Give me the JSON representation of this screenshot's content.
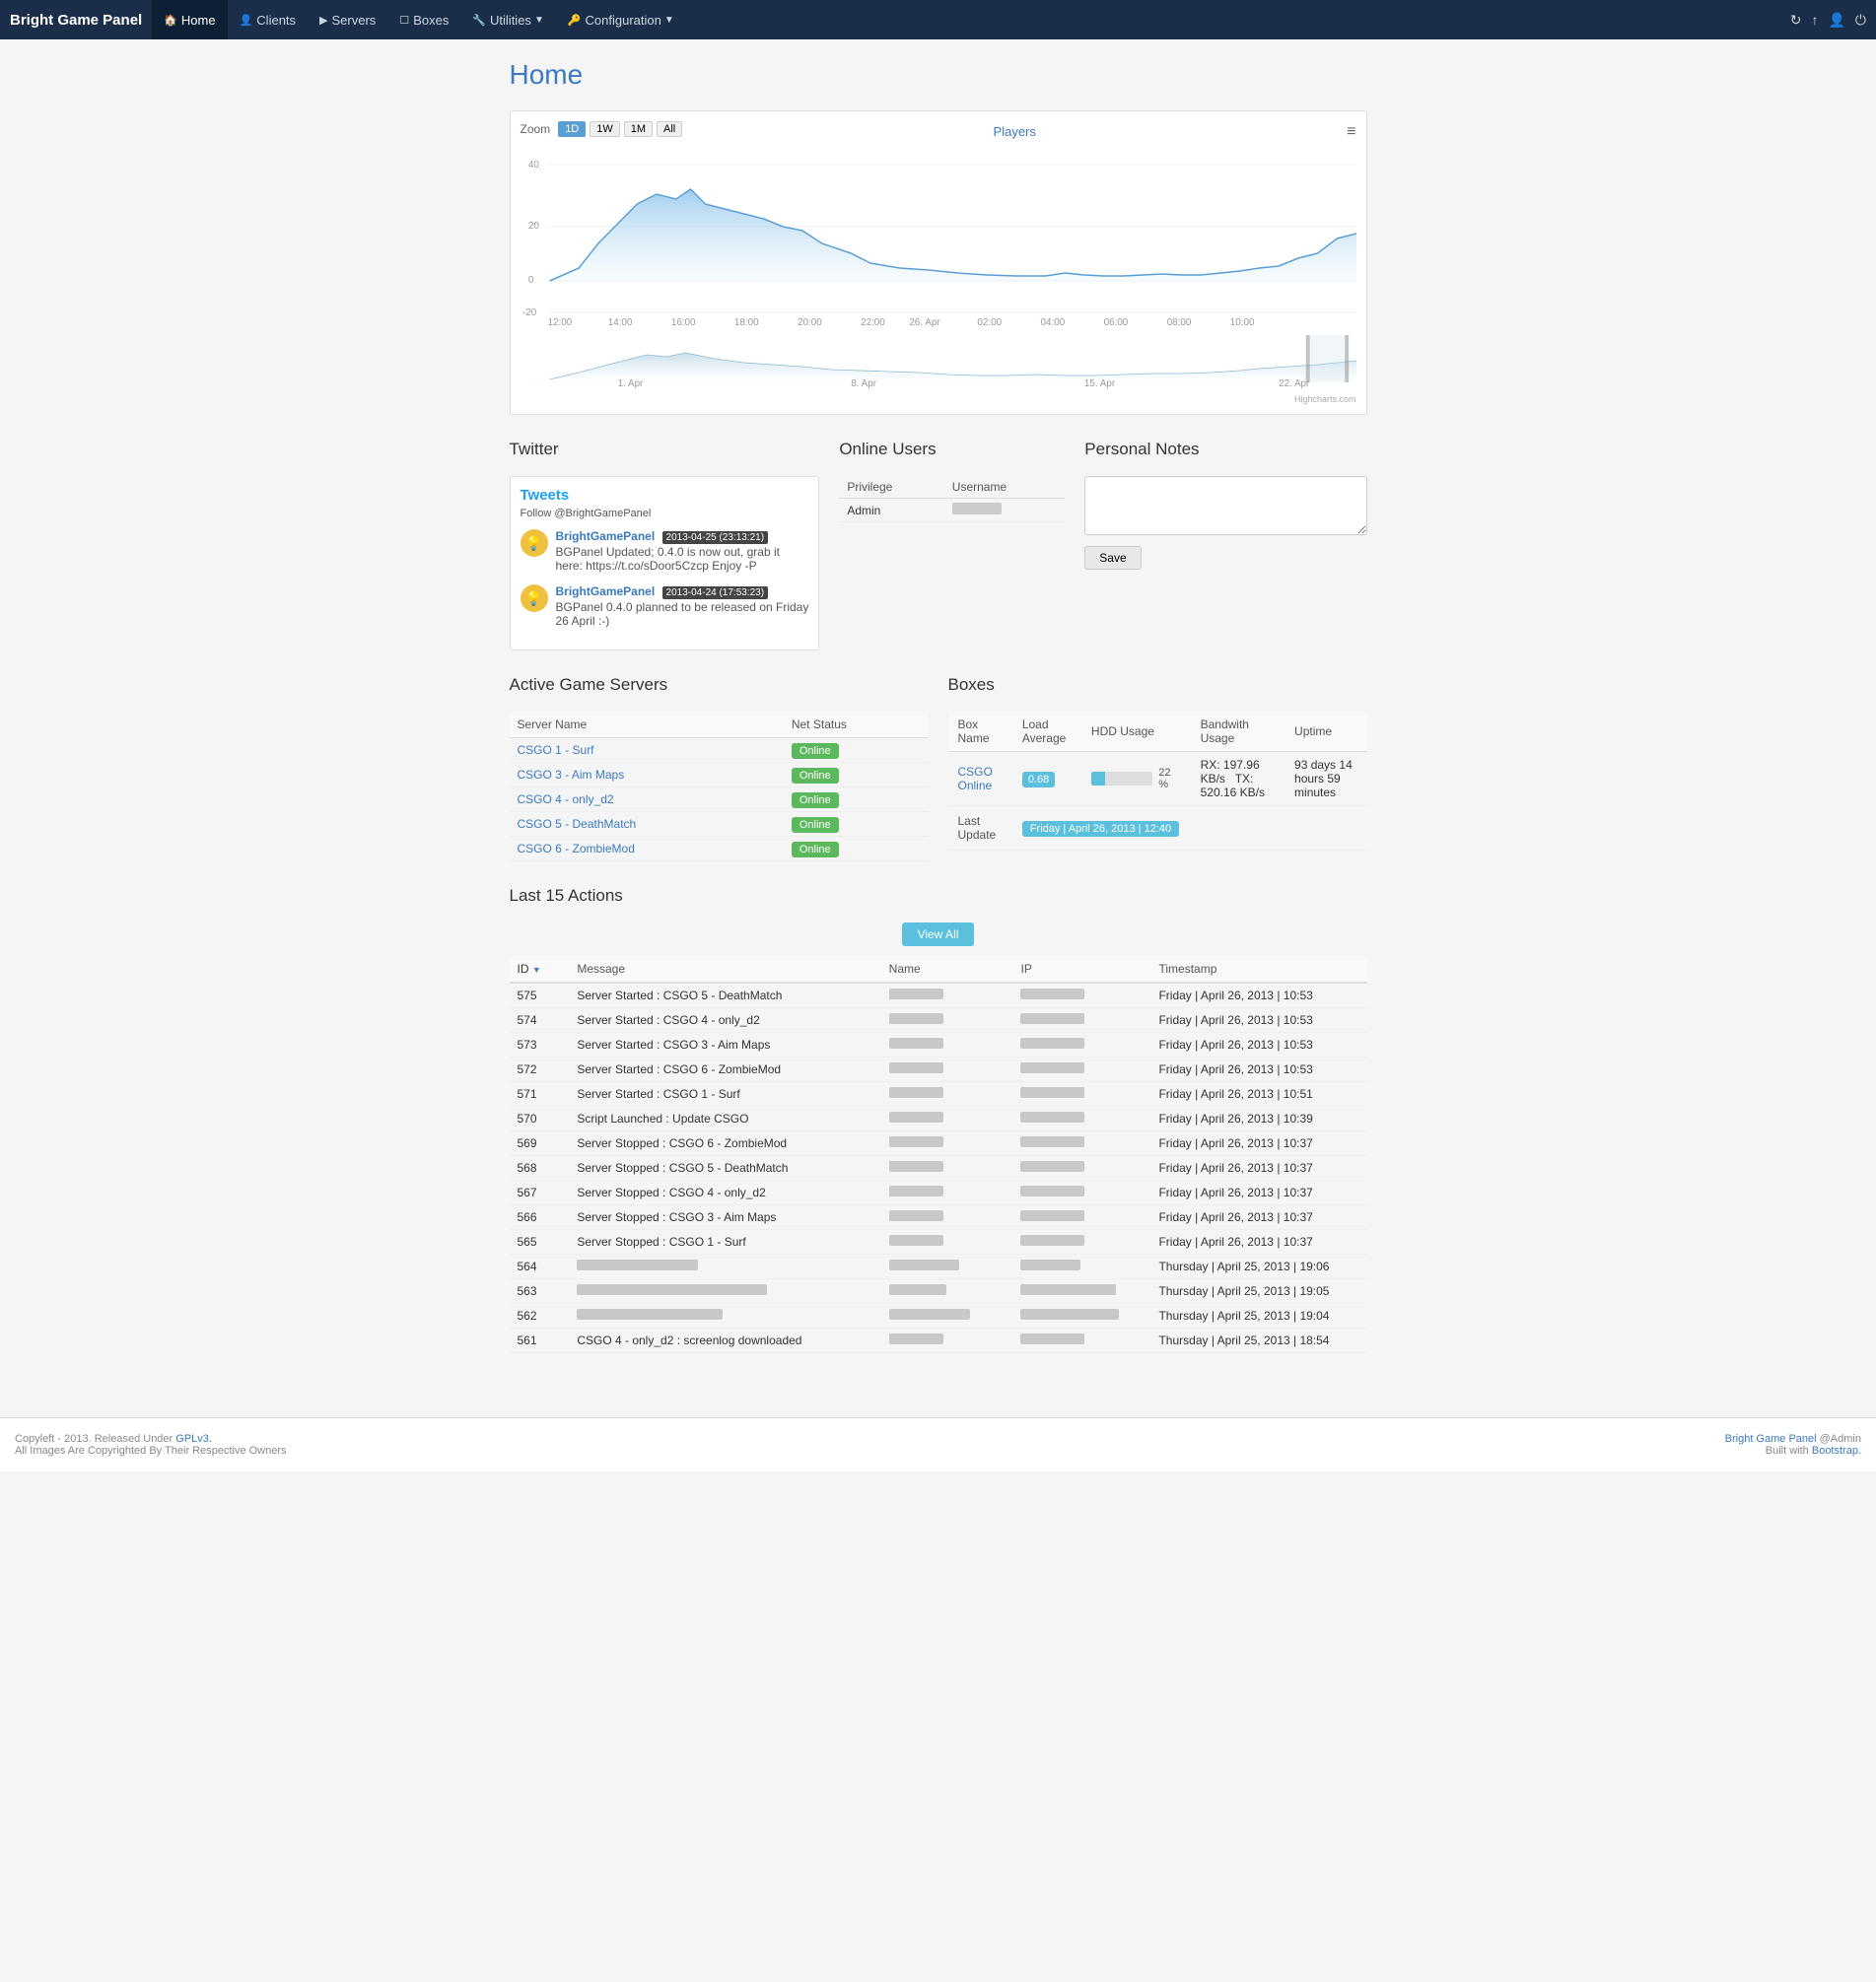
{
  "app": {
    "brand": "Bright Game Panel",
    "page_title": "Home"
  },
  "navbar": {
    "items": [
      {
        "label": "Home",
        "icon": "🏠",
        "active": true
      },
      {
        "label": "Clients",
        "icon": "👤",
        "active": false
      },
      {
        "label": "Servers",
        "icon": "▶",
        "active": false
      },
      {
        "label": "Boxes",
        "icon": "☐",
        "active": false
      },
      {
        "label": "Utilities",
        "icon": "🔧",
        "active": false,
        "dropdown": true
      },
      {
        "label": "Configuration",
        "icon": "🔑",
        "active": false,
        "dropdown": true
      }
    ],
    "right_icons": [
      "refresh-icon",
      "upload-icon",
      "user-icon",
      "settings-icon"
    ]
  },
  "chart": {
    "title": "Players",
    "zoom_label": "Zoom",
    "zoom_options": [
      "1D",
      "1W",
      "1M",
      "All"
    ],
    "zoom_active": "1D",
    "y_labels": [
      "40",
      "20",
      "0",
      "-20"
    ],
    "x_labels": [
      "12:00",
      "14:00",
      "16:00",
      "18:00",
      "20:00",
      "22:00",
      "26. Apr",
      "02:00",
      "04:00",
      "06:00",
      "08:00",
      "10:00"
    ],
    "mini_labels": [
      "1. Apr",
      "8. Apr",
      "15. Apr",
      "22. Apr"
    ],
    "credit": "Highcharts.com"
  },
  "twitter": {
    "section_title": "Twitter",
    "tweets_label": "Tweets",
    "follow_label": "Follow @BrightGamePanel",
    "items": [
      {
        "user": "BrightGamePanel",
        "date": "2013-04-25 (23:13:21)",
        "text": "BGPanel Updated; 0.4.0 is now out, grab it here: https://t.co/sDoor5Czcp Enjoy -P"
      },
      {
        "user": "BrightGamePanel",
        "date": "2013-04-24 (17:53:23)",
        "text": "BGPanel 0.4.0 planned to be released on Friday 26 April :-)"
      }
    ]
  },
  "online_users": {
    "section_title": "Online Users",
    "columns": [
      "Privilege",
      "Username"
    ],
    "rows": [
      {
        "privilege": "Admin",
        "username": ""
      }
    ]
  },
  "personal_notes": {
    "section_title": "Personal Notes",
    "placeholder": "",
    "save_label": "Save"
  },
  "active_servers": {
    "section_title": "Active Game Servers",
    "columns": [
      "Server Name",
      "Net Status"
    ],
    "rows": [
      {
        "name": "CSGO 1 - Surf",
        "status": "Online"
      },
      {
        "name": "CSGO 3 - Aim Maps",
        "status": "Online"
      },
      {
        "name": "CSGO 4 - only_d2",
        "status": "Online"
      },
      {
        "name": "CSGO 5 - DeathMatch",
        "status": "Online"
      },
      {
        "name": "CSGO 6 - ZombieMod",
        "status": "Online"
      }
    ]
  },
  "boxes": {
    "section_title": "Boxes",
    "columns": [
      "Box Name",
      "Load Average",
      "HDD Usage",
      "Bandwith Usage",
      "Uptime"
    ],
    "rows": [
      {
        "name": "CSGO Online",
        "load_average": "0.68",
        "hdd_percent": 22,
        "hdd_label": "22 %",
        "bandwidth": "RX: 197.96 KB/s   TX: 520.16 KB/s",
        "uptime": "93 days 14 hours 59 minutes"
      }
    ],
    "last_update_label": "Last Update",
    "last_update_value": "Friday | April 26, 2013 | 12:40"
  },
  "last_actions": {
    "section_title": "Last 15 Actions",
    "view_all_label": "View All",
    "columns": [
      "ID",
      "Message",
      "Name",
      "IP",
      "Timestamp"
    ],
    "rows": [
      {
        "id": "575",
        "message": "Server Started : CSGO 5 - DeathMatch",
        "name": "",
        "ip": "",
        "timestamp": "Friday | April 26, 2013 | 10:53",
        "blurred": false
      },
      {
        "id": "574",
        "message": "Server Started : CSGO 4 - only_d2",
        "name": "",
        "ip": "",
        "timestamp": "Friday | April 26, 2013 | 10:53",
        "blurred": false
      },
      {
        "id": "573",
        "message": "Server Started : CSGO 3 - Aim Maps",
        "name": "",
        "ip": "",
        "timestamp": "Friday | April 26, 2013 | 10:53",
        "blurred": false
      },
      {
        "id": "572",
        "message": "Server Started : CSGO 6 - ZombieMod",
        "name": "",
        "ip": "",
        "timestamp": "Friday | April 26, 2013 | 10:53",
        "blurred": false
      },
      {
        "id": "571",
        "message": "Server Started : CSGO 1 - Surf",
        "name": "",
        "ip": "",
        "timestamp": "Friday | April 26, 2013 | 10:51",
        "blurred": false
      },
      {
        "id": "570",
        "message": "Script Launched : Update CSGO",
        "name": "",
        "ip": "",
        "timestamp": "Friday | April 26, 2013 | 10:39",
        "blurred": false
      },
      {
        "id": "569",
        "message": "Server Stopped : CSGO 6 - ZombieMod",
        "name": "",
        "ip": "",
        "timestamp": "Friday | April 26, 2013 | 10:37",
        "blurred": false
      },
      {
        "id": "568",
        "message": "Server Stopped : CSGO 5 - DeathMatch",
        "name": "",
        "ip": "",
        "timestamp": "Friday | April 26, 2013 | 10:37",
        "blurred": false
      },
      {
        "id": "567",
        "message": "Server Stopped : CSGO 4 - only_d2",
        "name": "",
        "ip": "",
        "timestamp": "Friday | April 26, 2013 | 10:37",
        "blurred": false
      },
      {
        "id": "566",
        "message": "Server Stopped : CSGO 3 - Aim Maps",
        "name": "",
        "ip": "",
        "timestamp": "Friday | April 26, 2013 | 10:37",
        "blurred": false
      },
      {
        "id": "565",
        "message": "Server Stopped : CSGO 1 - Surf",
        "name": "",
        "ip": "",
        "timestamp": "Friday | April 26, 2013 | 10:37",
        "blurred": false
      },
      {
        "id": "564",
        "message": "",
        "name": "",
        "ip": "",
        "timestamp": "Thursday | April 25, 2013 | 19:06",
        "blurred": true
      },
      {
        "id": "563",
        "message": "",
        "name": "",
        "ip": "",
        "timestamp": "Thursday | April 25, 2013 | 19:05",
        "blurred": true
      },
      {
        "id": "562",
        "message": "",
        "name": "",
        "ip": "",
        "timestamp": "Thursday | April 25, 2013 | 19:04",
        "blurred": true
      },
      {
        "id": "561",
        "message": "CSGO 4 - only_d2 : screenlog downloaded",
        "name": "",
        "ip": "",
        "timestamp": "Thursday | April 25, 2013 | 18:54",
        "blurred": false
      }
    ]
  },
  "footer": {
    "left_line1": "Copyleft - 2013. Released Under ",
    "gpl_label": "GPLv3.",
    "gpl_href": "#",
    "left_line2": "All Images Are Copyrighted By Their Respective Owners",
    "right_brand": "Bright Game Panel",
    "right_admin": " @Admin",
    "right_line2": "Built with ",
    "bootstrap_label": "Bootstrap."
  }
}
